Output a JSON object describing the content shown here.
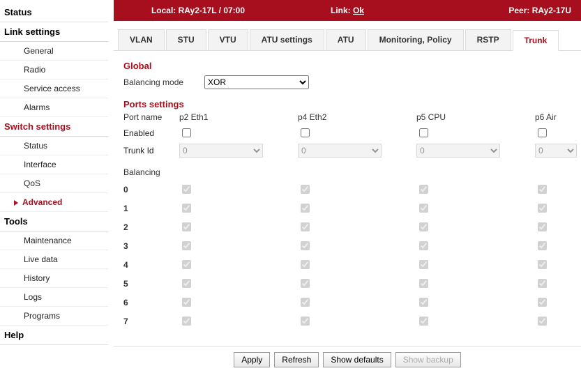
{
  "sidebar": {
    "status": "Status",
    "link_settings": "Link settings",
    "link_items": [
      "General",
      "Radio",
      "Service access",
      "Alarms"
    ],
    "switch_settings": "Switch settings",
    "switch_items": [
      "Status",
      "Interface",
      "QoS",
      "Advanced"
    ],
    "tools": "Tools",
    "tools_items": [
      "Maintenance",
      "Live data",
      "History",
      "Logs",
      "Programs"
    ],
    "help": "Help"
  },
  "topbar": {
    "local_label": "Local:",
    "local_value": "RAy2-17L / 07:00",
    "link_label": "Link:",
    "link_value": "Ok",
    "peer_label": "Peer:",
    "peer_value": "RAy2-17U"
  },
  "tabs": [
    "VLAN",
    "STU",
    "VTU",
    "ATU settings",
    "ATU",
    "Monitoring, Policy",
    "RSTP",
    "Trunk"
  ],
  "active_tab": "Trunk",
  "global": {
    "title": "Global",
    "balancing_mode_label": "Balancing mode",
    "balancing_mode_value": "XOR"
  },
  "ports": {
    "title": "Ports settings",
    "port_name_label": "Port name",
    "columns": [
      "p2 Eth1",
      "p4 Eth2",
      "p5 CPU",
      "p6 Air"
    ],
    "enabled_label": "Enabled",
    "enabled": [
      false,
      false,
      false,
      false
    ],
    "trunk_id_label": "Trunk Id",
    "trunk_id": [
      "0",
      "0",
      "0",
      "0"
    ]
  },
  "balancing": {
    "title": "Balancing",
    "rows": [
      "0",
      "1",
      "2",
      "3",
      "4",
      "5",
      "6",
      "7"
    ],
    "grid": [
      [
        true,
        true,
        true,
        true
      ],
      [
        true,
        true,
        true,
        true
      ],
      [
        true,
        true,
        true,
        true
      ],
      [
        true,
        true,
        true,
        true
      ],
      [
        true,
        true,
        true,
        true
      ],
      [
        true,
        true,
        true,
        true
      ],
      [
        true,
        true,
        true,
        true
      ],
      [
        true,
        true,
        true,
        true
      ]
    ]
  },
  "footer": {
    "apply": "Apply",
    "refresh": "Refresh",
    "show_defaults": "Show defaults",
    "show_backup": "Show backup"
  }
}
